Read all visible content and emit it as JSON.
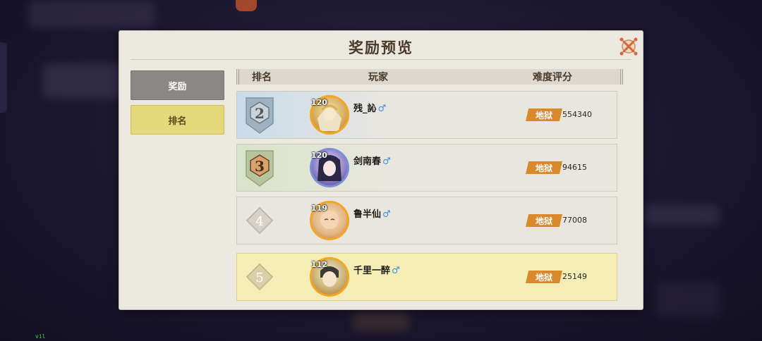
{
  "dialog": {
    "title": "奖励预览"
  },
  "sidebar": {
    "items": [
      {
        "label": "奖励",
        "active": false
      },
      {
        "label": "排名",
        "active": true
      }
    ]
  },
  "table": {
    "headers": {
      "rank": "排名",
      "player": "玩家",
      "score": "难度评分"
    },
    "rows": [
      {
        "rank": "2",
        "level": "120",
        "name": "残_訫",
        "gender": "♂",
        "difficulty": "地狱",
        "score": "554340",
        "highlighted": false
      },
      {
        "rank": "3",
        "level": "120",
        "name": "剑南春",
        "gender": "♂",
        "difficulty": "地狱",
        "score": "94615",
        "highlighted": false
      },
      {
        "rank": "4",
        "level": "119",
        "name": "鲁半仙",
        "gender": "♂",
        "difficulty": "地狱",
        "score": "77008",
        "highlighted": false
      },
      {
        "rank": "5",
        "level": "112",
        "name": "千里一醉",
        "gender": "♂",
        "difficulty": "地狱",
        "score": "25149",
        "highlighted": true
      }
    ]
  },
  "colors": {
    "panel_bg": "#ebe8e0",
    "active_tab": "#e5d87a",
    "inactive_tab": "#8a8784",
    "difficulty_tag": "#d7892c",
    "highlight_row": "#f5edb6",
    "male_symbol": "#3c8fe0"
  },
  "icons": {
    "close": "close-icon",
    "male": "male-icon"
  }
}
